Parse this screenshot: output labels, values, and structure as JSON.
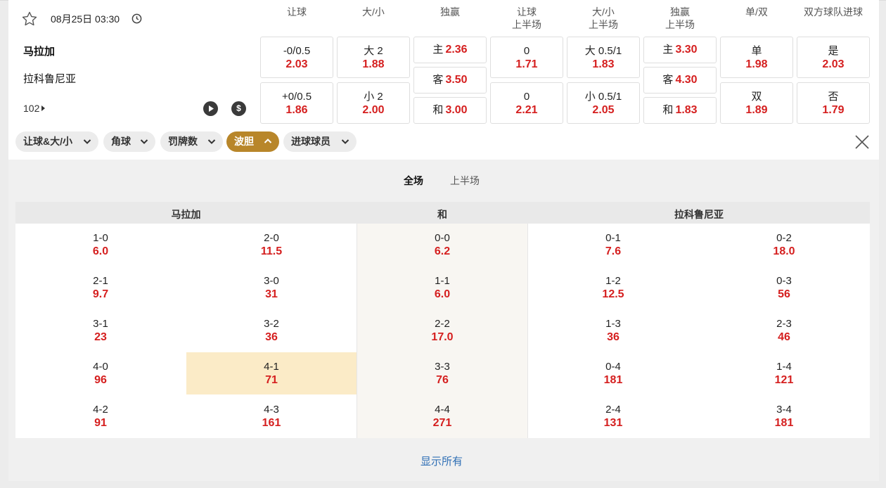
{
  "match": {
    "datetime": "08月25日 03:30",
    "home_team": "马拉加",
    "away_team": "拉科鲁尼亚",
    "more_markets": "102"
  },
  "column_headers": [
    "让球",
    "大/小",
    "独赢",
    "让球\n上半场",
    "大/小\n上半场",
    "独赢\n上半场",
    "单/双",
    "双方球队进球"
  ],
  "odds": {
    "handicap": [
      {
        "line": "-0/0.5",
        "odd": "2.03"
      },
      {
        "line": "+0/0.5",
        "odd": "1.86"
      }
    ],
    "over_under": [
      {
        "line": "大 2",
        "odd": "1.88"
      },
      {
        "line": "小 2",
        "odd": "2.00"
      }
    ],
    "moneyline": [
      {
        "line": "主",
        "odd": "2.36"
      },
      {
        "line": "客",
        "odd": "3.50"
      },
      {
        "line": "和",
        "odd": "3.00"
      }
    ],
    "handicap_1h": [
      {
        "line": "0",
        "odd": "1.71"
      },
      {
        "line": "0",
        "odd": "2.21"
      }
    ],
    "over_under_1h": [
      {
        "line": "大 0.5/1",
        "odd": "1.83"
      },
      {
        "line": "小 0.5/1",
        "odd": "2.05"
      }
    ],
    "moneyline_1h": [
      {
        "line": "主",
        "odd": "3.30"
      },
      {
        "line": "客",
        "odd": "4.30"
      },
      {
        "line": "和",
        "odd": "1.83"
      }
    ],
    "odd_even": [
      {
        "line": "单",
        "odd": "1.98"
      },
      {
        "line": "双",
        "odd": "1.89"
      }
    ],
    "both_score": [
      {
        "line": "是",
        "odd": "2.03"
      },
      {
        "line": "否",
        "odd": "1.79"
      }
    ]
  },
  "market_tabs": [
    {
      "label": "让球&大/小",
      "active": false
    },
    {
      "label": "角球",
      "active": false
    },
    {
      "label": "罚牌数",
      "active": false
    },
    {
      "label": "波胆",
      "active": true
    },
    {
      "label": "进球球员",
      "active": false
    }
  ],
  "period_tabs": {
    "full": "全场",
    "first_half": "上半场"
  },
  "correct_score": {
    "headers": {
      "home": "马拉加",
      "draw": "和",
      "away": "拉科鲁尼亚"
    },
    "columns": [
      [
        {
          "score": "1-0",
          "odd": "6.0"
        },
        {
          "score": "2-1",
          "odd": "9.7"
        },
        {
          "score": "3-1",
          "odd": "23"
        },
        {
          "score": "4-0",
          "odd": "96"
        },
        {
          "score": "4-2",
          "odd": "91"
        }
      ],
      [
        {
          "score": "2-0",
          "odd": "11.5"
        },
        {
          "score": "3-0",
          "odd": "31"
        },
        {
          "score": "3-2",
          "odd": "36"
        },
        {
          "score": "4-1",
          "odd": "71"
        },
        {
          "score": "4-3",
          "odd": "161"
        }
      ],
      [
        {
          "score": "0-0",
          "odd": "6.2"
        },
        {
          "score": "1-1",
          "odd": "6.0"
        },
        {
          "score": "2-2",
          "odd": "17.0"
        },
        {
          "score": "3-3",
          "odd": "76"
        },
        {
          "score": "4-4",
          "odd": "271"
        }
      ],
      [
        {
          "score": "0-1",
          "odd": "7.6"
        },
        {
          "score": "1-2",
          "odd": "12.5"
        },
        {
          "score": "1-3",
          "odd": "36"
        },
        {
          "score": "0-4",
          "odd": "181"
        },
        {
          "score": "2-4",
          "odd": "131"
        }
      ],
      [
        {
          "score": "0-2",
          "odd": "18.0"
        },
        {
          "score": "0-3",
          "odd": "56"
        },
        {
          "score": "2-3",
          "odd": "46"
        },
        {
          "score": "1-4",
          "odd": "121"
        },
        {
          "score": "3-4",
          "odd": "181"
        }
      ]
    ],
    "highlighted": "4-1"
  },
  "show_all": "显示所有",
  "colors": {
    "odd_red": "#d51f1f",
    "active_tab": "#b8862a",
    "highlight": "#fbebc7",
    "link": "#2f6fb5"
  }
}
